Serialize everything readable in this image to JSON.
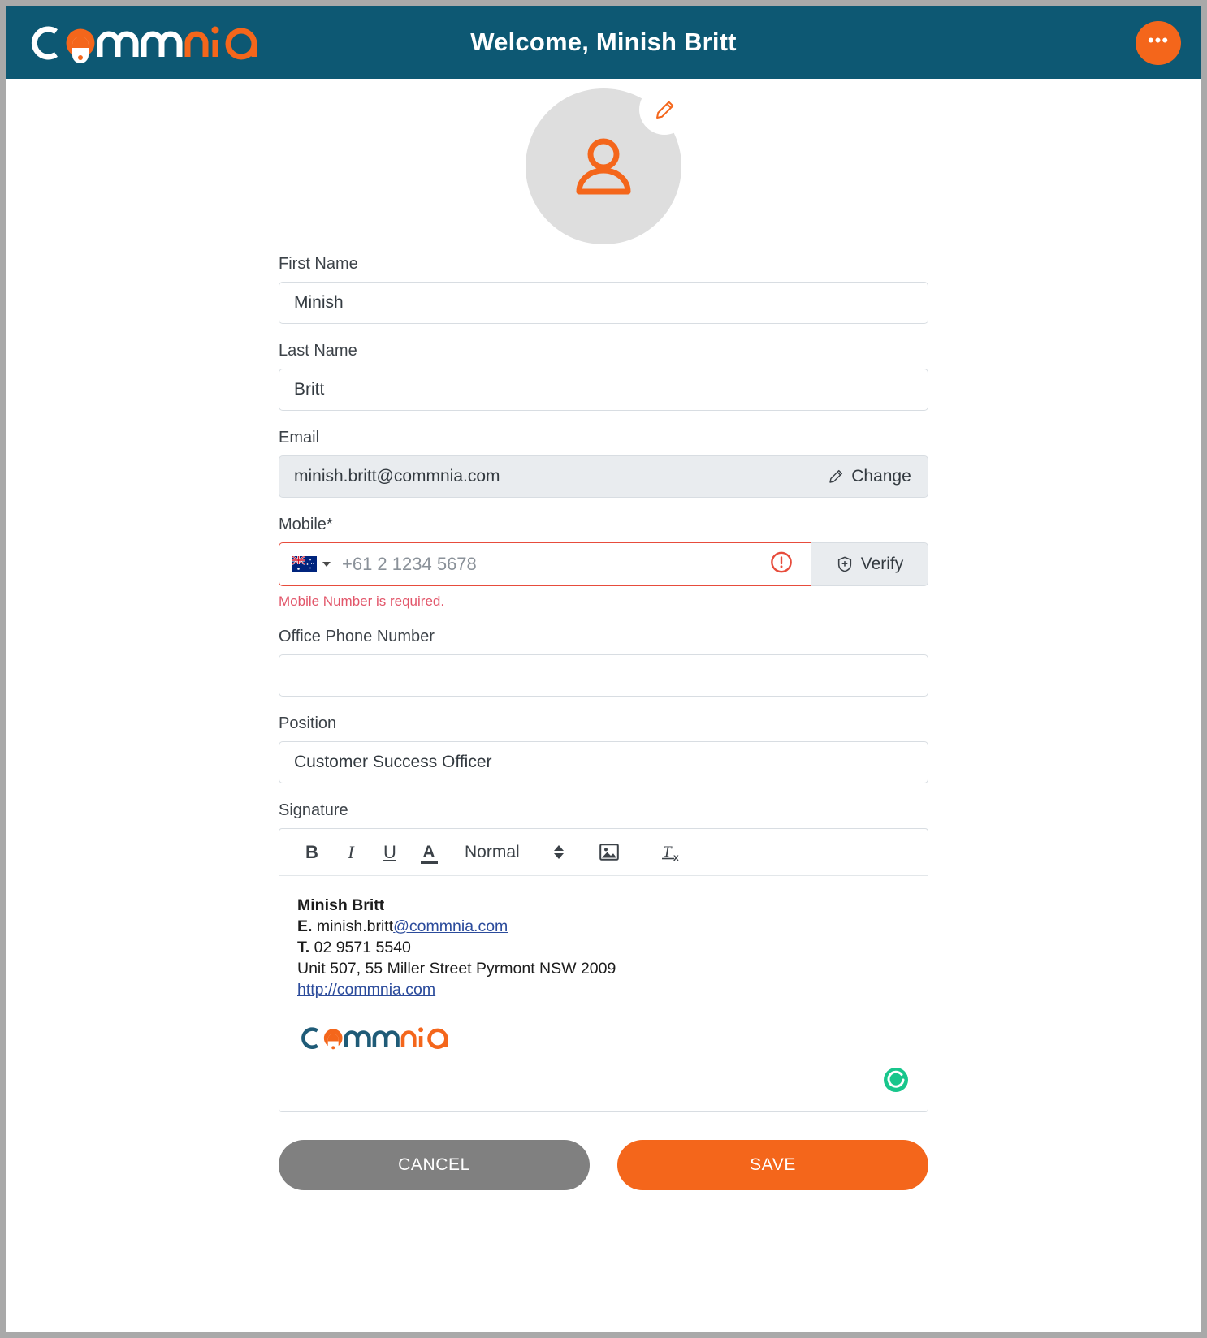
{
  "header": {
    "logo_text_primary": "comm",
    "logo_text_accent": "nia",
    "title": "Welcome, Minish Britt",
    "menu_label": "•••",
    "bg_color": "#0d5873",
    "accent_color": "#f4661b"
  },
  "avatar": {
    "person_icon": "person-icon",
    "edit_icon": "pencil-icon"
  },
  "form": {
    "first_name": {
      "label": "First Name",
      "value": "Minish",
      "placeholder": ""
    },
    "last_name": {
      "label": "Last Name",
      "value": "Britt",
      "placeholder": ""
    },
    "email": {
      "label": "Email",
      "value": "minish.britt@commnia.com",
      "change_label": "Change",
      "change_icon": "pencil-icon"
    },
    "mobile": {
      "label": "Mobile*",
      "value": "",
      "placeholder": "+61 2 1234 5678",
      "country_flag": "australia-flag",
      "verify_label": "Verify",
      "verify_icon": "shield-plus-icon",
      "error_icon": "exclamation-circle-icon",
      "error_message": "Mobile Number is required.",
      "error_color": "#e2566a"
    },
    "office_phone": {
      "label": "Office Phone Number",
      "value": "",
      "placeholder": ""
    },
    "position": {
      "label": "Position",
      "value": "Customer Success Officer",
      "placeholder": ""
    },
    "signature": {
      "label": "Signature"
    }
  },
  "editor": {
    "tools": [
      {
        "name": "bold-icon",
        "label": "B"
      },
      {
        "name": "italic-icon",
        "label": "I"
      },
      {
        "name": "underline-icon",
        "label": "U"
      },
      {
        "name": "text-color-icon",
        "label": "A"
      }
    ],
    "style_value": "Normal",
    "image_icon": "image-icon",
    "clear_format_icon": "clear-formatting-icon",
    "refresh_icon": "refresh-icon",
    "refresh_color": "#18c68c"
  },
  "signature_content": {
    "name": "Minish Britt",
    "email_label": "E.",
    "email_plain": "minish.britt",
    "email_link": "@commnia.com",
    "phone_label": "T.",
    "phone": "02 9571 5540",
    "address": "Unit 507, 55 Miller Street Pyrmont NSW 2009",
    "website": "http://commnia.com",
    "logo_primary": "comm",
    "logo_accent": "nia",
    "logo_primary_color": "#1f5b77",
    "logo_accent_color": "#f4661b"
  },
  "actions": {
    "cancel_label": "CANCEL",
    "save_label": "SAVE",
    "cancel_color": "#808080",
    "save_color": "#f4661b"
  }
}
